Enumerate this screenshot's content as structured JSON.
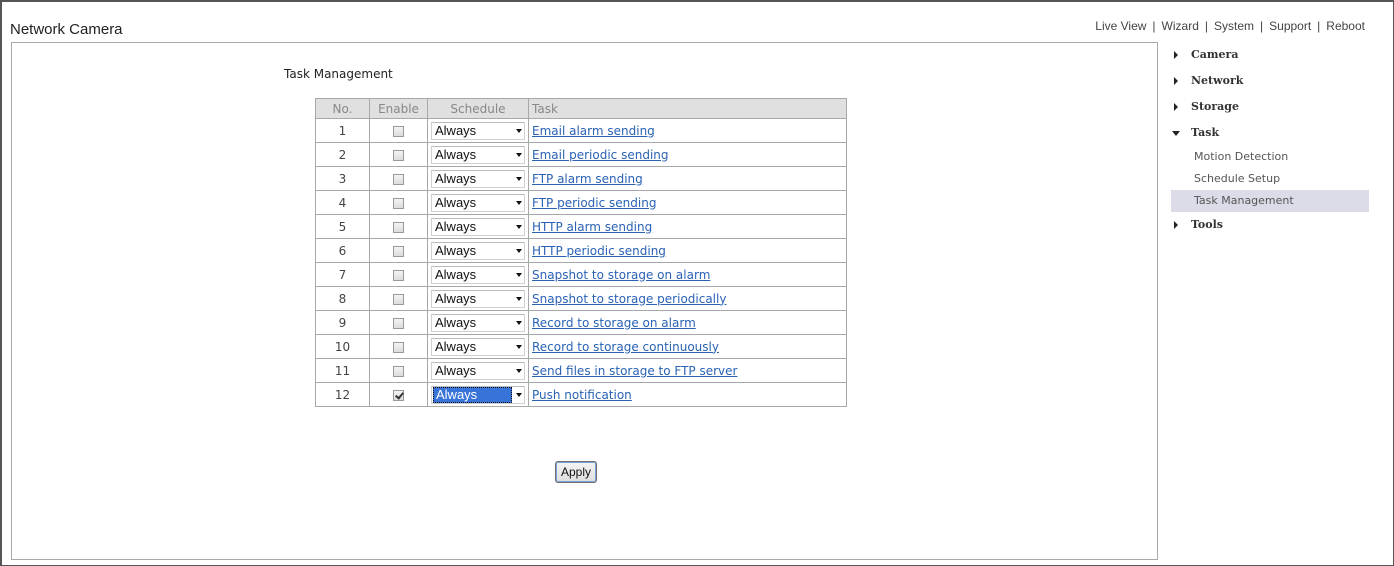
{
  "app_title": "Network Camera",
  "topnav": [
    {
      "label": "Live View"
    },
    {
      "label": "Wizard"
    },
    {
      "label": "System"
    },
    {
      "label": "Support"
    },
    {
      "label": "Reboot"
    }
  ],
  "section_title": "Task Management",
  "table": {
    "headers": {
      "no": "No.",
      "enable": "Enable",
      "schedule": "Schedule",
      "task": "Task"
    },
    "rows": [
      {
        "no": "1",
        "enabled": false,
        "schedule": "Always",
        "task": "Email alarm sending"
      },
      {
        "no": "2",
        "enabled": false,
        "schedule": "Always",
        "task": "Email periodic sending"
      },
      {
        "no": "3",
        "enabled": false,
        "schedule": "Always",
        "task": "FTP alarm sending"
      },
      {
        "no": "4",
        "enabled": false,
        "schedule": "Always",
        "task": "FTP periodic sending"
      },
      {
        "no": "5",
        "enabled": false,
        "schedule": "Always",
        "task": "HTTP alarm sending"
      },
      {
        "no": "6",
        "enabled": false,
        "schedule": "Always",
        "task": "HTTP periodic sending"
      },
      {
        "no": "7",
        "enabled": false,
        "schedule": "Always",
        "task": "Snapshot to storage on alarm"
      },
      {
        "no": "8",
        "enabled": false,
        "schedule": "Always",
        "task": "Snapshot to storage periodically"
      },
      {
        "no": "9",
        "enabled": false,
        "schedule": "Always",
        "task": "Record to storage on alarm"
      },
      {
        "no": "10",
        "enabled": false,
        "schedule": "Always",
        "task": "Record to storage continuously"
      },
      {
        "no": "11",
        "enabled": false,
        "schedule": "Always",
        "task": "Send files in storage to FTP server"
      },
      {
        "no": "12",
        "enabled": true,
        "schedule": "Always",
        "task": "Push notification",
        "focused": true
      }
    ]
  },
  "apply_label": "Apply",
  "sidebar": {
    "items": [
      {
        "label": "Camera",
        "expanded": false
      },
      {
        "label": "Network",
        "expanded": false
      },
      {
        "label": "Storage",
        "expanded": false
      },
      {
        "label": "Task",
        "expanded": true,
        "children": [
          {
            "label": "Motion Detection",
            "active": false
          },
          {
            "label": "Schedule Setup",
            "active": false
          },
          {
            "label": "Task Management",
            "active": true
          }
        ]
      },
      {
        "label": "Tools",
        "expanded": false
      }
    ]
  },
  "colors": {
    "link": "#2a62b4",
    "header_bg": "#e0e0e0",
    "active_menu_bg": "#dcdce8",
    "select_highlight": "#3874d8"
  }
}
